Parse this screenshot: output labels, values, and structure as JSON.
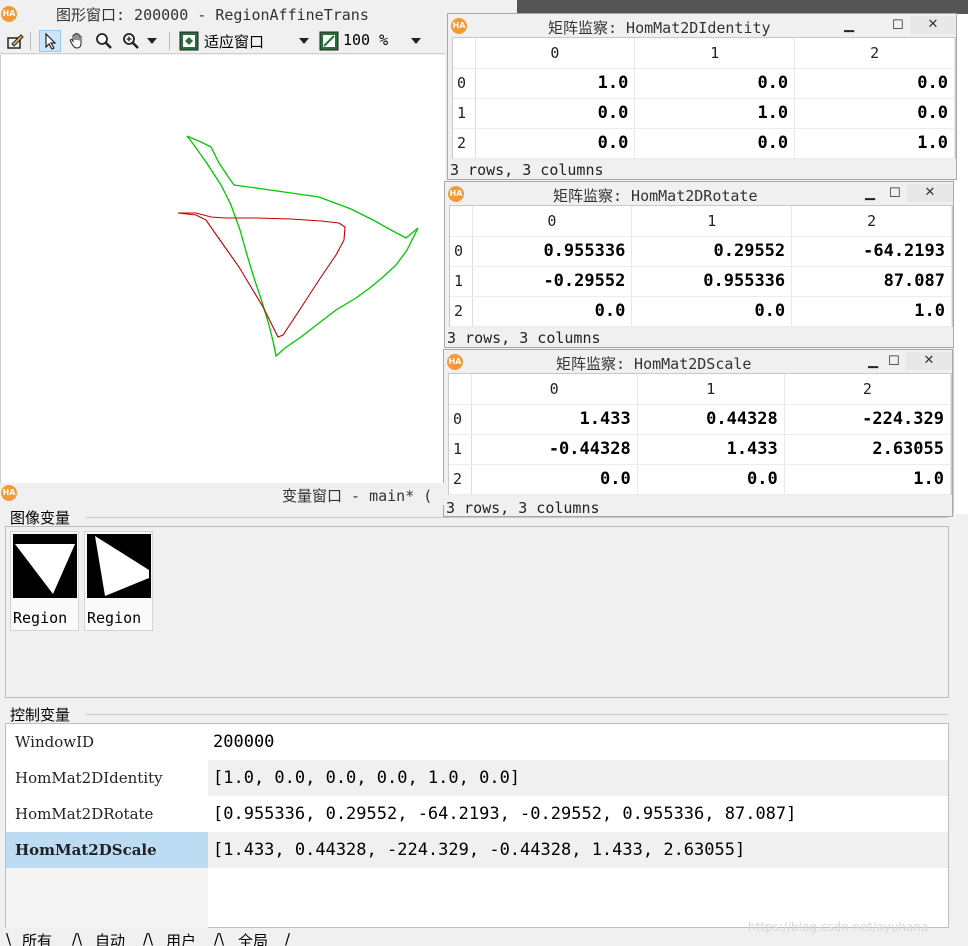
{
  "graphics_window": {
    "title": "图形窗口: 200000 - RegionAffineTrans",
    "toolbar": {
      "fit_label": "适应窗口",
      "zoom_value": "100 %"
    }
  },
  "matrix_windows": [
    {
      "title": "矩阵监察: HomMat2DIdentity",
      "columns": [
        "0",
        "1",
        "2"
      ],
      "rows": [
        {
          "index": "0",
          "values": [
            "1.0",
            "0.0",
            "0.0"
          ]
        },
        {
          "index": "1",
          "values": [
            "0.0",
            "1.0",
            "0.0"
          ]
        },
        {
          "index": "2",
          "values": [
            "0.0",
            "0.0",
            "1.0"
          ]
        }
      ],
      "status": "3 rows, 3 columns"
    },
    {
      "title": "矩阵监察: HomMat2DRotate",
      "columns": [
        "0",
        "1",
        "2"
      ],
      "rows": [
        {
          "index": "0",
          "values": [
            "0.955336",
            "0.29552",
            "-64.2193"
          ]
        },
        {
          "index": "1",
          "values": [
            "-0.29552",
            "0.955336",
            "87.087"
          ]
        },
        {
          "index": "2",
          "values": [
            "0.0",
            "0.0",
            "1.0"
          ]
        }
      ],
      "status": "3 rows, 3 columns"
    },
    {
      "title": "矩阵监察: HomMat2DScale",
      "columns": [
        "0",
        "1",
        "2"
      ],
      "rows": [
        {
          "index": "0",
          "values": [
            "1.433",
            "0.44328",
            "-224.329"
          ]
        },
        {
          "index": "1",
          "values": [
            "-0.44328",
            "1.433",
            "2.63055"
          ]
        },
        {
          "index": "2",
          "values": [
            "0.0",
            "0.0",
            "1.0"
          ]
        }
      ],
      "status": "3 rows, 3 columns"
    }
  ],
  "variable_window": {
    "title": "变量窗口 - main* (",
    "image_vars_label": "图像变量",
    "image_vars": [
      {
        "label": "Region"
      },
      {
        "label": "Region"
      }
    ],
    "control_vars_label": "控制变量",
    "control_vars": [
      {
        "name": "WindowID",
        "value": "200000"
      },
      {
        "name": "HomMat2DIdentity",
        "value": "[1.0, 0.0, 0.0, 0.0, 1.0, 0.0]"
      },
      {
        "name": "HomMat2DRotate",
        "value": "[0.955336, 0.29552, -64.2193, -0.29552, 0.955336, 87.087]"
      },
      {
        "name": "HomMat2DScale",
        "value": "[1.433, 0.44328, -224.329, -0.44328, 1.433, 2.63055]"
      }
    ],
    "tabs": [
      "所有",
      "自动",
      "用户",
      "全局"
    ]
  },
  "watermark": "https://blog.csdn.net/ayuhana",
  "colors": {
    "region_original": "#c00000",
    "region_transformed": "#00c800",
    "selection": "#bcdcf4",
    "logo": "#f29a38"
  },
  "icons": [
    "halcon-logo-icon",
    "draw-icon",
    "pointer-icon",
    "pan-hand-icon",
    "zoom-icon",
    "zoom-in-icon",
    "fit-window-icon",
    "zoom-percent-icon",
    "minimize-icon",
    "maximize-icon",
    "close-icon"
  ]
}
